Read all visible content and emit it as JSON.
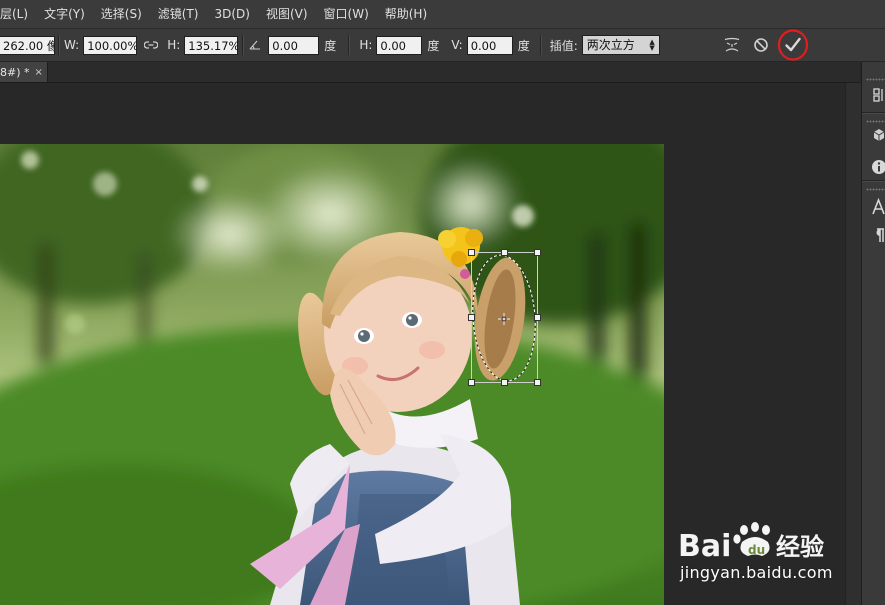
{
  "menu": {
    "items": [
      "层(L)",
      "文字(Y)",
      "选择(S)",
      "滤镜(T)",
      "3D(D)",
      "视图(V)",
      "窗口(W)",
      "帮助(H)"
    ]
  },
  "options": {
    "x_value": "262.00 像",
    "w_label": "W:",
    "w_value": "100.00%",
    "h_label": "H:",
    "h_value": "135.17%",
    "rotate_value": "0.00",
    "rotate_unit": "度",
    "skew_h_label": "H:",
    "skew_h_value": "0.00",
    "skew_h_unit": "度",
    "skew_v_label": "V:",
    "skew_v_value": "0.00",
    "skew_v_unit": "度",
    "interp_label": "插值:",
    "interp_value": "两次立方"
  },
  "tab": {
    "label": "8#) *",
    "close": "×"
  },
  "watermark": {
    "logo_text": "Bai经验",
    "url": "jingyan.baidu.com"
  },
  "colors": {
    "accent_highlight": "#e11d1d",
    "menu_bg": "#3b3b3b",
    "canvas_bg": "#282828"
  },
  "icons": [
    "link-icon",
    "angle-icon",
    "warp-icon",
    "cancel-icon",
    "commit-check-icon",
    "dropdown-arrow-icon"
  ]
}
